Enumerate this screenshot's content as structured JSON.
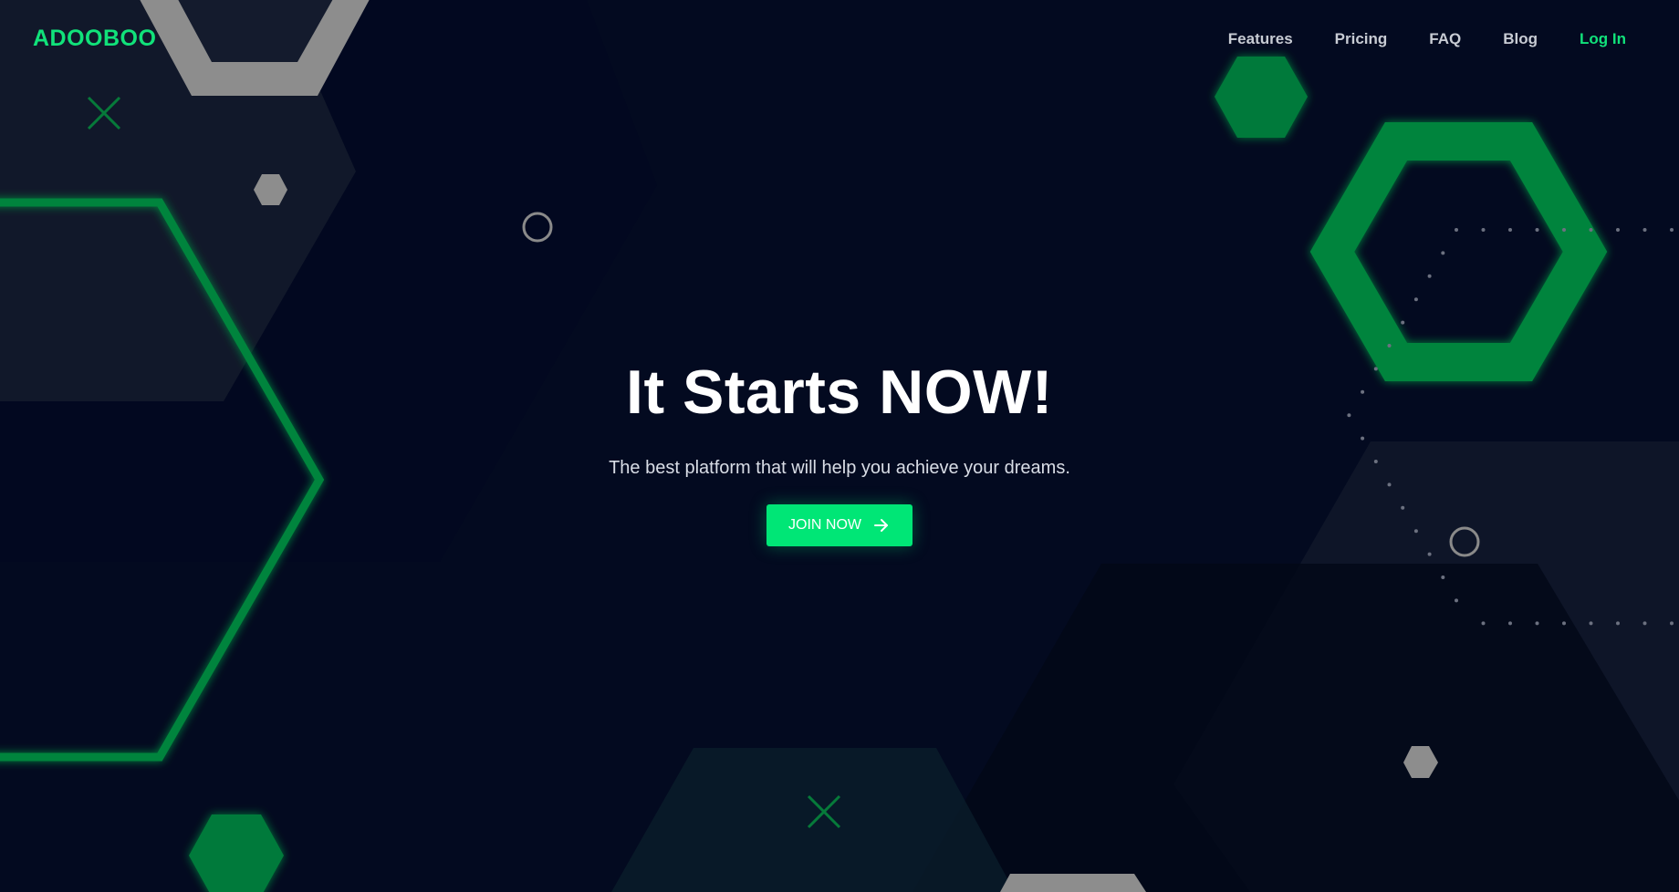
{
  "brand": {
    "logo": "ADOOBOO"
  },
  "nav": {
    "items": [
      {
        "label": "Features"
      },
      {
        "label": "Pricing"
      },
      {
        "label": "FAQ"
      },
      {
        "label": "Blog"
      }
    ],
    "login_label": "Log In"
  },
  "hero": {
    "title": "It Starts NOW!",
    "subtitle": "The best platform that will help you achieve your dreams.",
    "cta_label": "JOIN NOW",
    "cta_icon": "arrow-right-icon"
  },
  "colors": {
    "background": "#030a20",
    "accent": "#00e676",
    "accent_dark": "#067a3a",
    "shape_gray": "#8c8c8c",
    "nav_text": "#c8ccd4"
  },
  "decorations": [
    "hexagon-outline-icon",
    "hexagon-icon",
    "circle-outline-icon",
    "cross-icon",
    "dotted-path"
  ]
}
